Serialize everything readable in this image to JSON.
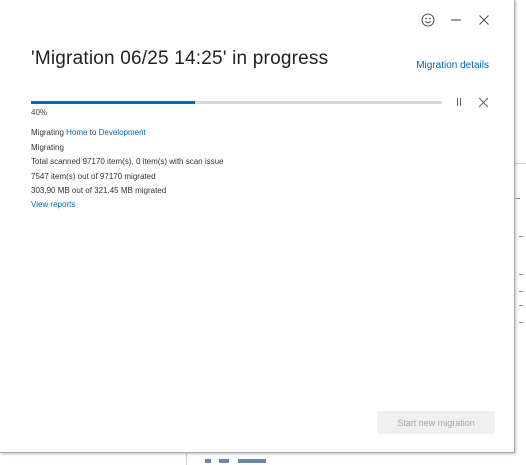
{
  "dialog": {
    "title": "'Migration 06/25 14:25' in progress",
    "details_link": "Migration details",
    "progress": {
      "fraction": 0.4,
      "label": "40%",
      "color": "#0f67b1"
    },
    "info": {
      "migrating_prefix": "Migrating",
      "source": "Home",
      "to_word": "to",
      "destination": "Development",
      "status": "Migrating",
      "scanned": "Total scanned 97170 item(s), 0 item(s) with scan issue",
      "items_migrated": "7547 item(s) out of 97170 migrated",
      "size_migrated": "303.90 MB out of 321.45 MB migrated",
      "view_reports": "View reports"
    },
    "start_button": "Start new migration"
  },
  "background_window": {
    "bottom_text": "",
    "accent_color": "#6d86a8"
  },
  "icons": {
    "feedback": "smiley-icon",
    "minimize": "minimize-icon",
    "close": "close-icon",
    "pause": "pause-icon",
    "cancel": "cancel-icon"
  },
  "colors": {
    "link": "#0066b8",
    "title": "#222222",
    "disabled_text": "#a5a5a5",
    "disabled_bg": "#f0f0f0"
  }
}
